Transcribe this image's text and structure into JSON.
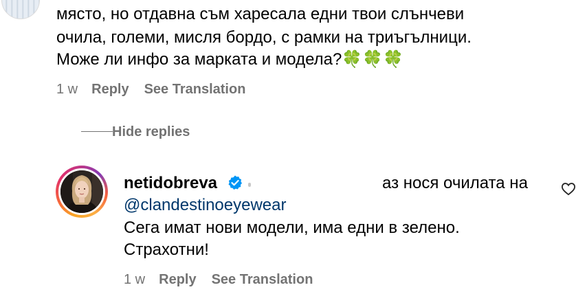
{
  "parent_comment": {
    "lines": [
      "място, но отдавна съм харесала едни твои слънчеви",
      "очила, големи, мисля бордо, с рамки на триъгълници.",
      "Може ли инфо за марката и модела?"
    ],
    "emoji": "🍀🍀🍀",
    "time": "1 w",
    "reply_label": "Reply",
    "translate_label": "See Translation"
  },
  "hide_replies_label": "Hide replies",
  "reply": {
    "username": "netidobreva",
    "text_start": "аз нося очилата на",
    "mention": "@clandestinoeyewear",
    "lines": [
      "Сега имат нови модели, има едни в зелено.",
      "Страхотни!"
    ],
    "time": "1 w",
    "reply_label": "Reply",
    "translate_label": "See Translation"
  },
  "colors": {
    "meta_gray": "#737373",
    "mention_blue": "#00376b",
    "verified_blue": "#0095f6"
  },
  "icons": {
    "verified": "verified-badge-icon",
    "like": "heart-outline-icon",
    "emoji": "four-leaf-clover"
  }
}
